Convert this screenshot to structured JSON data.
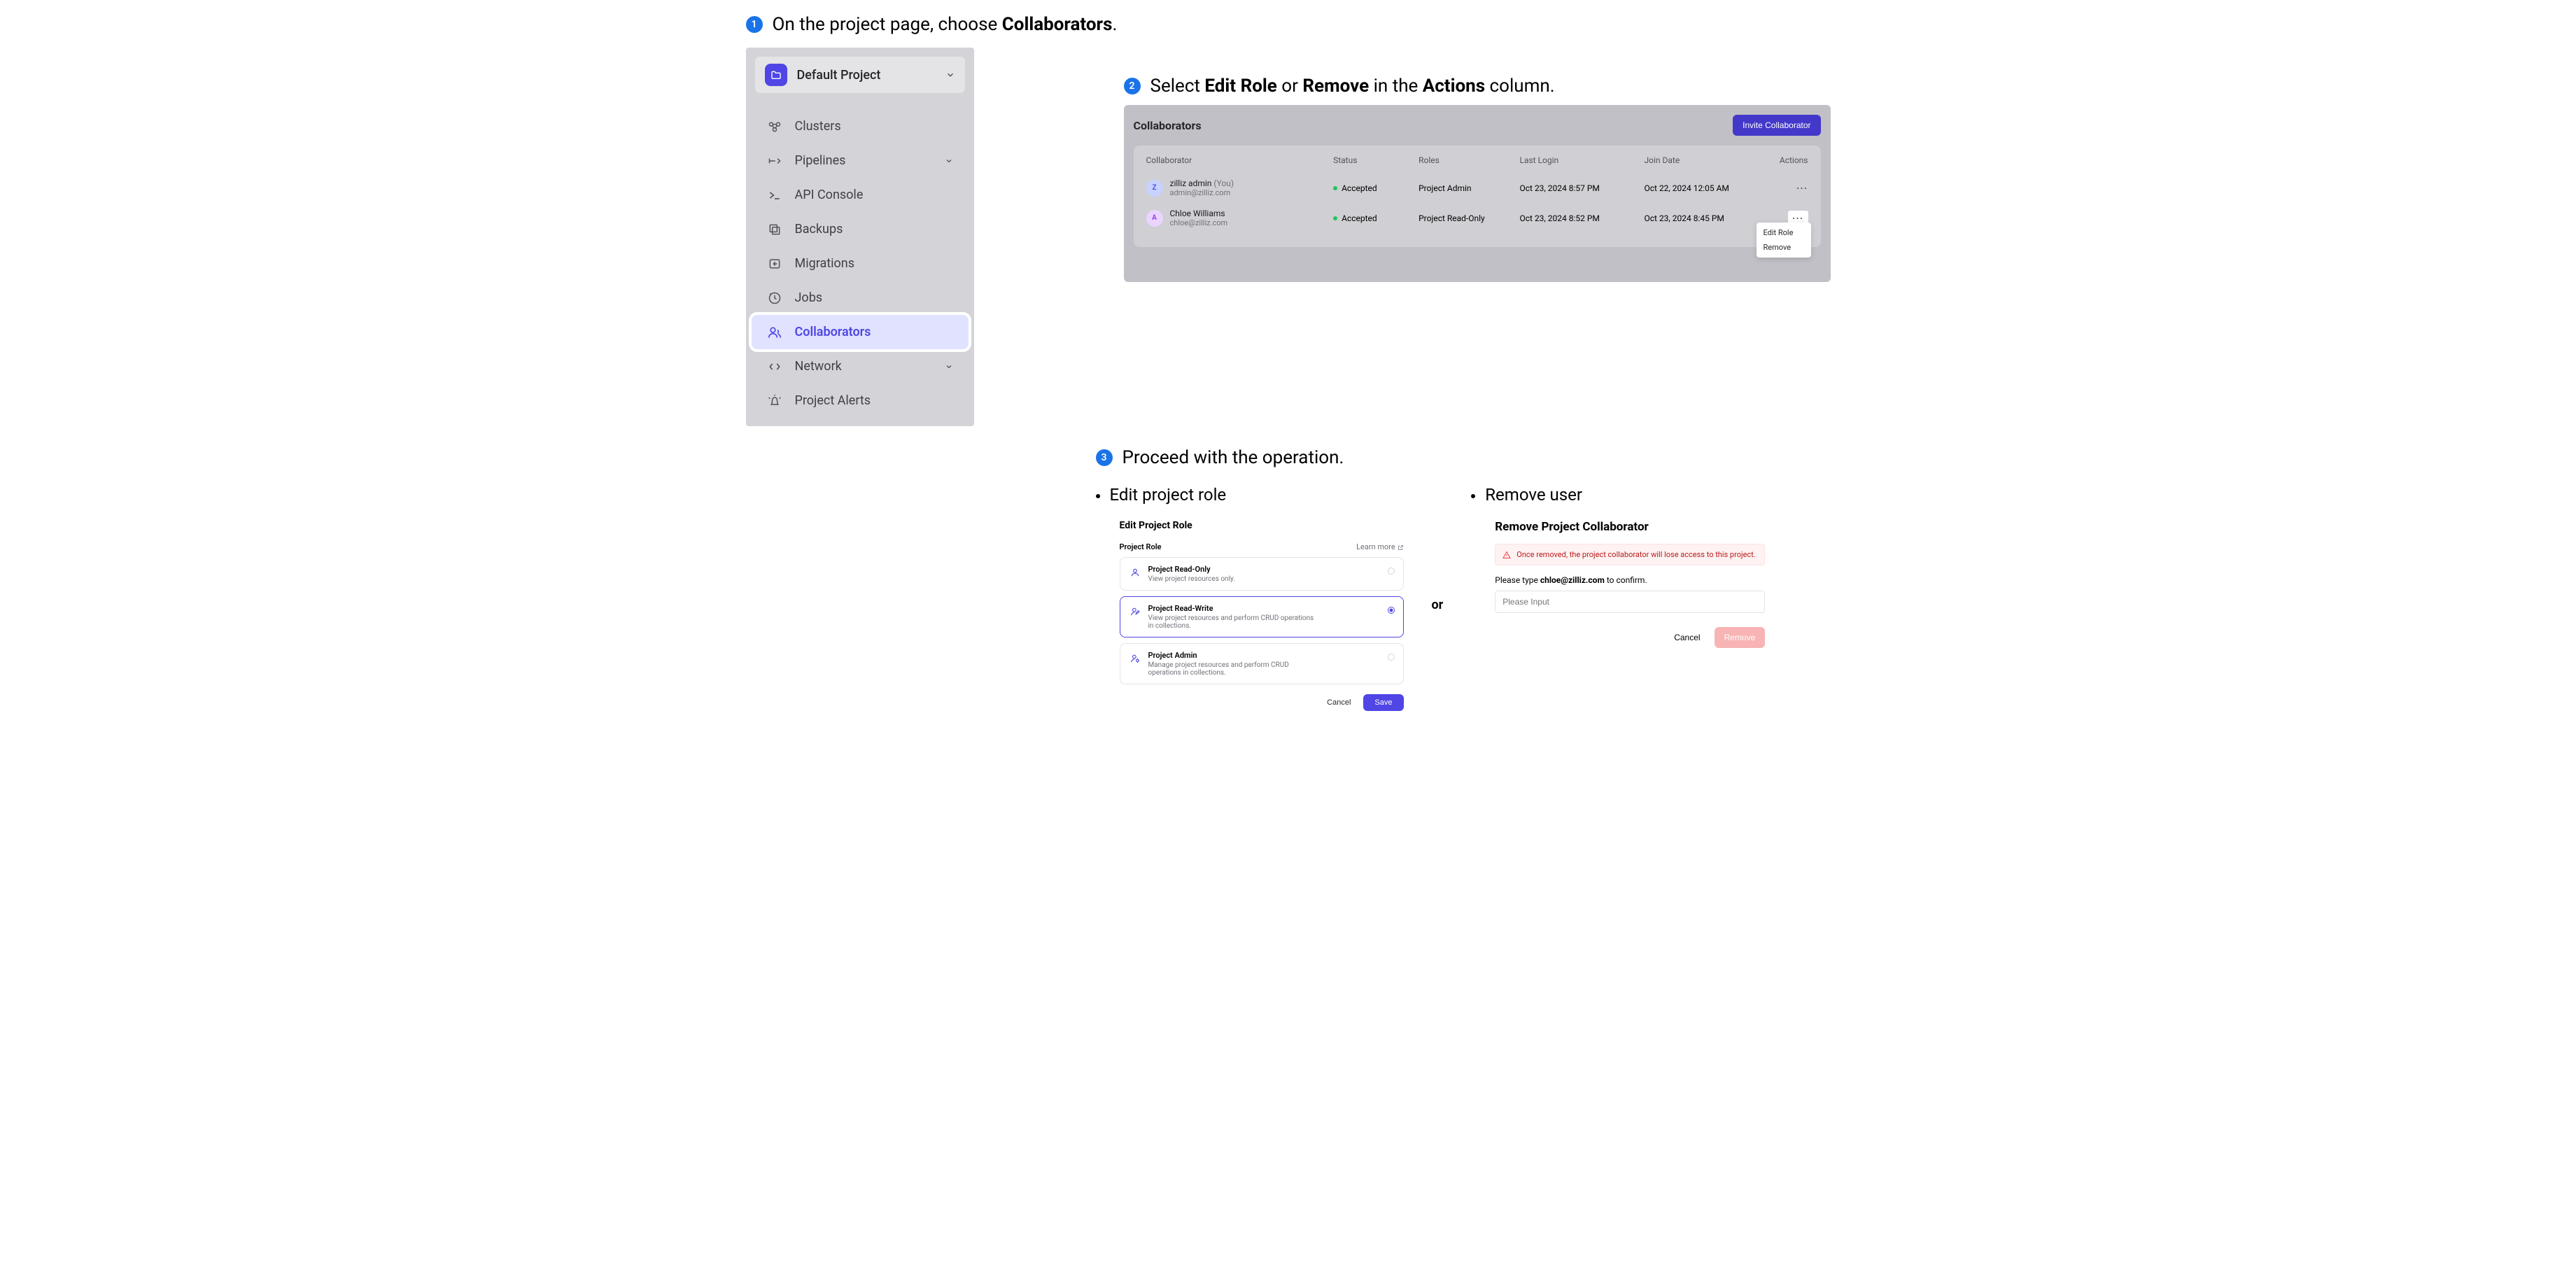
{
  "step1": {
    "num": "1",
    "prefix": "On the project page, choose ",
    "bold": "Collaborators",
    "suffix": "."
  },
  "step2": {
    "num": "2",
    "p1": "Select ",
    "b1": "Edit Role",
    "p2": " or ",
    "b2": "Remove",
    "p3": " in the ",
    "b3": "Actions",
    "p4": " column."
  },
  "step3": {
    "num": "3",
    "text": "Proceed with the operation."
  },
  "sidebar": {
    "project": "Default Project",
    "items": [
      {
        "label": "Clusters"
      },
      {
        "label": "Pipelines"
      },
      {
        "label": "API Console"
      },
      {
        "label": "Backups"
      },
      {
        "label": "Migrations"
      },
      {
        "label": "Jobs"
      },
      {
        "label": "Collaborators"
      },
      {
        "label": "Network"
      },
      {
        "label": "Project Alerts"
      }
    ]
  },
  "collab": {
    "title": "Collaborators",
    "invite": "Invite Collaborator",
    "columns": {
      "c0": "Collaborator",
      "c1": "Status",
      "c2": "Roles",
      "c3": "Last Login",
      "c4": "Join Date",
      "c5": "Actions"
    },
    "rows": [
      {
        "initial": "Z",
        "name": "zilliz admin",
        "you": " (You)",
        "email": "admin@zilliz.com",
        "status": "Accepted",
        "role": "Project Admin",
        "last": "Oct 23, 2024 8:57 PM",
        "join": "Oct 22, 2024 12:05 AM"
      },
      {
        "initial": "A",
        "name": "Chloe Williams",
        "you": "",
        "email": "chloe@zilliz.com",
        "status": "Accepted",
        "role": "Project Read-Only",
        "last": "Oct 23, 2024 8:52 PM",
        "join": "Oct 23, 2024 8:45 PM"
      }
    ],
    "menu": {
      "edit": "Edit Role",
      "remove": "Remove"
    }
  },
  "or_label": "or",
  "editCol": {
    "head": "Edit project role"
  },
  "editDlg": {
    "title": "Edit Project Role",
    "section": "Project Role",
    "learn": "Learn more",
    "roles": [
      {
        "name": "Project Read-Only",
        "desc": "View project resources only."
      },
      {
        "name": "Project Read-Write",
        "desc": "View project resources and perform CRUD operations in collections."
      },
      {
        "name": "Project Admin",
        "desc": "Manage project resources and perform CRUD operations in collections."
      }
    ],
    "cancel": "Cancel",
    "save": "Save"
  },
  "removeCol": {
    "head": "Remove user"
  },
  "removeDlg": {
    "title": "Remove Project Collaborator",
    "warn": "Once removed, the project collaborator will lose access to this project.",
    "confirm_pre": "Please type ",
    "confirm_email": "chloe@zilliz.com",
    "confirm_post": " to confirm.",
    "placeholder": "Please Input",
    "cancel": "Cancel",
    "remove": "Remove"
  }
}
